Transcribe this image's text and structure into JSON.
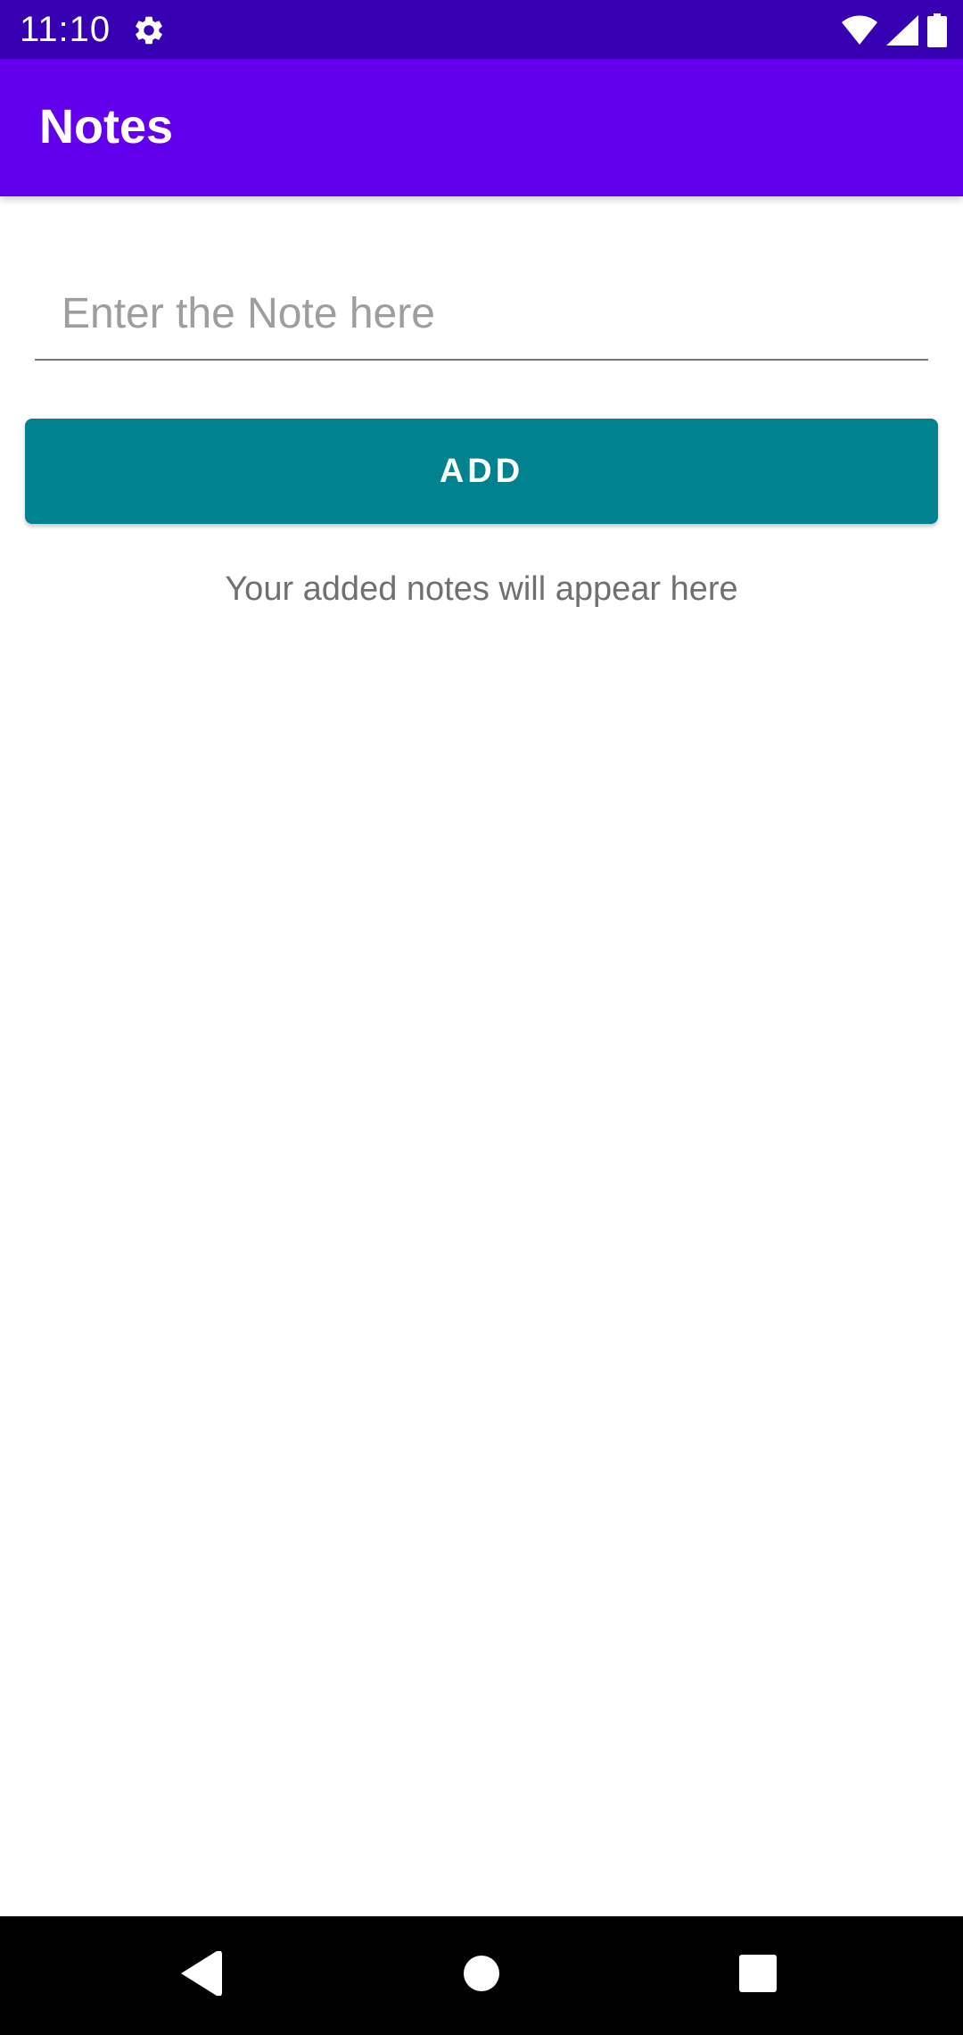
{
  "status_bar": {
    "time": "11:10",
    "icons": [
      "settings-gear-icon",
      "wifi-icon",
      "cell-signal-icon",
      "battery-icon"
    ]
  },
  "app_bar": {
    "title": "Notes"
  },
  "note_input": {
    "value": "",
    "placeholder": "Enter the Note here"
  },
  "add_button": {
    "label": "ADD"
  },
  "empty_state": {
    "text": "Your added notes will appear here"
  },
  "nav_bar": {
    "buttons": [
      "back-icon",
      "home-icon",
      "recents-icon"
    ]
  },
  "colors": {
    "status_bar": "#3700b3",
    "app_bar": "#6200ee",
    "button": "#00838f",
    "empty_text": "#707070"
  }
}
